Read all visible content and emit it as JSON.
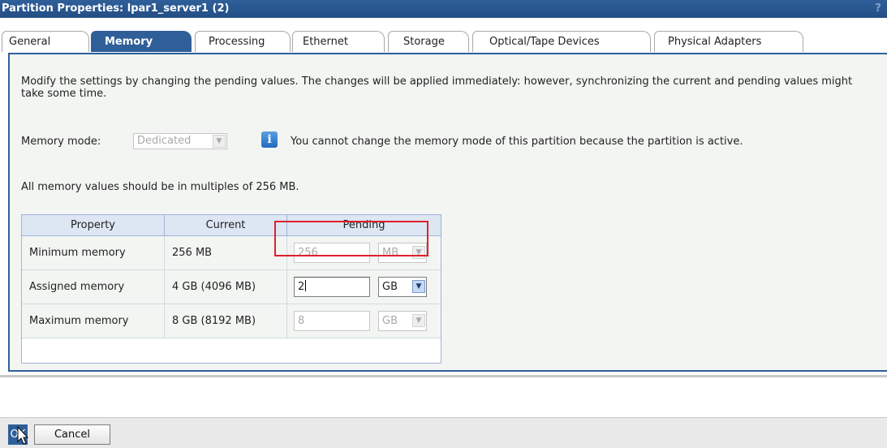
{
  "window": {
    "title": "Partition Properties: lpar1_server1 (2)",
    "help": "?"
  },
  "tabs": [
    {
      "label": "General"
    },
    {
      "label": "Memory"
    },
    {
      "label": "Processing"
    },
    {
      "label": "Ethernet"
    },
    {
      "label": "Storage"
    },
    {
      "label": "Optical/Tape Devices"
    },
    {
      "label": "Physical Adapters"
    }
  ],
  "memory": {
    "description": "Modify the settings by changing the pending values. The changes will be applied immediately: however, synchronizing the current and pending values might take some time.",
    "mode_label": "Memory mode:",
    "mode_value": "Dedicated",
    "info_glyph": "i",
    "info_text": "You cannot change the memory mode of this partition because the partition is active.",
    "multiples_note": "All memory values should be in multiples of 256 MB.",
    "table": {
      "headers": {
        "property": "Property",
        "current": "Current",
        "pending": "Pending"
      },
      "rows": [
        {
          "property": "Minimum memory",
          "current": "256 MB",
          "pending_value": "256",
          "pending_unit": "MB"
        },
        {
          "property": "Assigned memory",
          "current": "4 GB (4096 MB)",
          "pending_value": "2",
          "pending_unit": "GB"
        },
        {
          "property": "Maximum memory",
          "current": "8 GB (8192 MB)",
          "pending_value": "8",
          "pending_unit": "GB"
        }
      ]
    }
  },
  "footer": {
    "ok_label": "OK",
    "cancel_label": "Cancel"
  },
  "colors": {
    "titlebar": "#2f5f99",
    "highlight": "#e0202c",
    "panel_bg": "#f2f5f2"
  }
}
